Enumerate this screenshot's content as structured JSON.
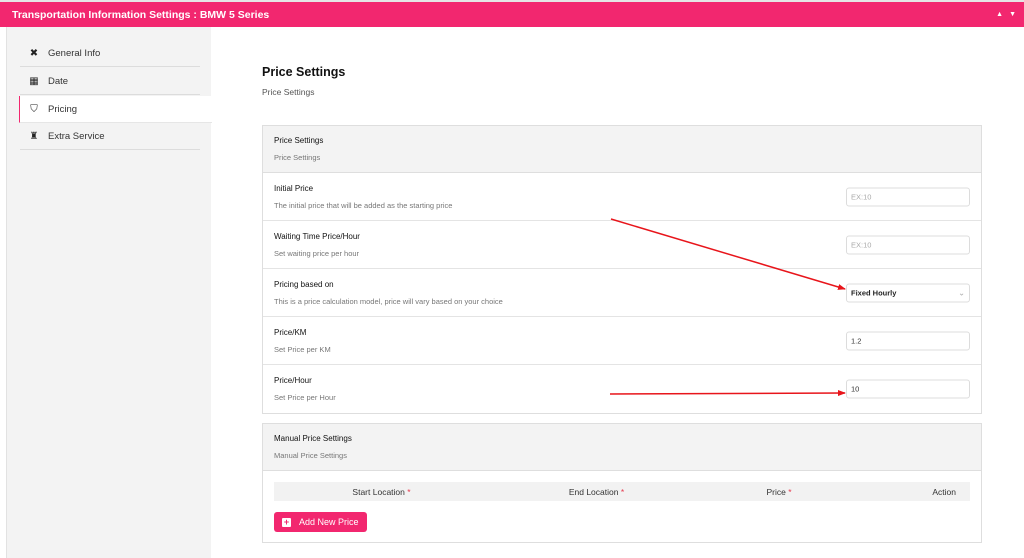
{
  "window": {
    "title": "Transportation Information Settings : BMW 5 Series",
    "collapse_up_icon": "▲",
    "collapse_down_icon": "▼"
  },
  "sidebar": {
    "items": [
      {
        "label": "General Info",
        "icon": "tools-icon",
        "glyph": "✖",
        "active": false
      },
      {
        "label": "Date",
        "icon": "calendar-icon",
        "glyph": "▦",
        "active": false
      },
      {
        "label": "Pricing",
        "icon": "hand-coin-icon",
        "glyph": "⛉",
        "active": true
      },
      {
        "label": "Extra Service",
        "icon": "puzzle-icon",
        "glyph": "♜",
        "active": false
      }
    ]
  },
  "main": {
    "heading": "Price Settings",
    "subheading": "Price Settings",
    "price_panel": {
      "title": "Price Settings",
      "subtitle": "Price Settings",
      "rows": [
        {
          "label": "Initial Price",
          "description": "The initial price that will be added as the starting price",
          "value": "",
          "placeholder": "EX:10"
        },
        {
          "label": "Waiting Time Price/Hour",
          "description": "Set waiting price per hour",
          "value": "",
          "placeholder": "EX:10"
        },
        {
          "label": "Pricing based on",
          "description": "This is a price calculation model, price will vary based on your choice",
          "selected": "Fixed Hourly"
        },
        {
          "label": "Price/KM",
          "description": "Set Price per KM",
          "value": "1.2",
          "placeholder": ""
        },
        {
          "label": "Price/Hour",
          "description": "Set Price per Hour",
          "value": "10",
          "placeholder": ""
        }
      ]
    },
    "manual_panel": {
      "title": "Manual Price Settings",
      "subtitle": "Manual Price Settings",
      "columns": [
        "Start Location",
        "End Location",
        "Price",
        "Action"
      ],
      "required_mark": "*",
      "add_button": "Add New Price"
    }
  },
  "annotations": {
    "color": "#e8151b",
    "arrows": [
      {
        "points_to": "pricing-based-on-select"
      },
      {
        "points_to": "price-hour-input"
      }
    ]
  }
}
